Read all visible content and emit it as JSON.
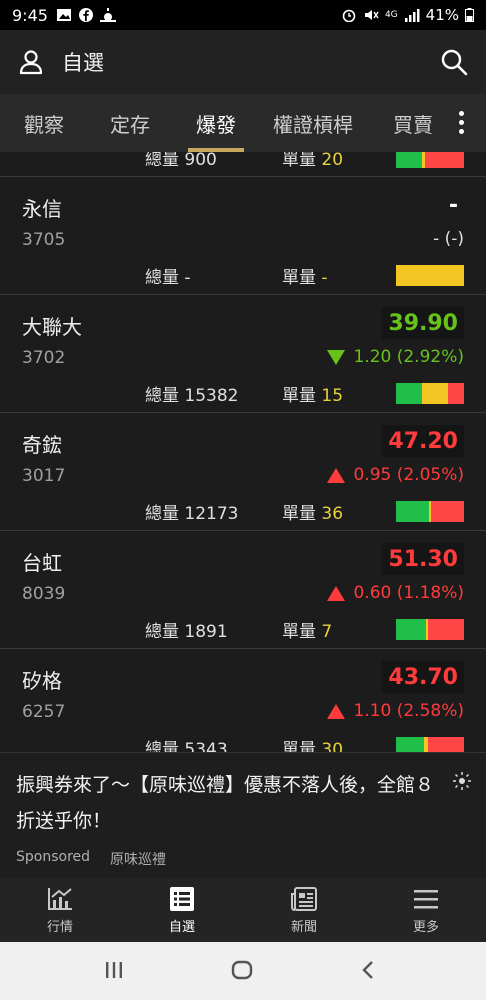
{
  "status_bar": {
    "time": "9:45",
    "battery": "41%",
    "network": "4G"
  },
  "header": {
    "title": "自選"
  },
  "tabs": [
    "觀察",
    "定存",
    "爆發",
    "權證槓桿",
    "買賣"
  ],
  "active_tab": "爆發",
  "stocks": [
    {
      "name": "",
      "code": "",
      "price": "",
      "change": "",
      "volume_label": "總量",
      "volume": "900",
      "unit_label": "單量",
      "unit": "20",
      "direction": "none"
    },
    {
      "name": "永信",
      "code": "3705",
      "price": "-",
      "change": "- (-)",
      "volume_label": "總量",
      "volume": "-",
      "unit_label": "單量",
      "unit": "-",
      "direction": "none"
    },
    {
      "name": "大聯大",
      "code": "3702",
      "price": "39.90",
      "change": "1.20 (2.92%)",
      "volume_label": "總量",
      "volume": "15382",
      "unit_label": "單量",
      "unit": "15",
      "direction": "down"
    },
    {
      "name": "奇鋐",
      "code": "3017",
      "price": "47.20",
      "change": "0.95 (2.05%)",
      "volume_label": "總量",
      "volume": "12173",
      "unit_label": "單量",
      "unit": "36",
      "direction": "up"
    },
    {
      "name": "台虹",
      "code": "8039",
      "price": "51.30",
      "change": "0.60 (1.18%)",
      "volume_label": "總量",
      "volume": "1891",
      "unit_label": "單量",
      "unit": "7",
      "direction": "up"
    },
    {
      "name": "矽格",
      "code": "6257",
      "price": "43.70",
      "change": "1.10 (2.58%)",
      "volume_label": "總量",
      "volume": "5343",
      "unit_label": "單量",
      "unit": "30",
      "direction": "up"
    }
  ],
  "ad": {
    "text": "振興券來了～【原味巡禮】優惠不落人後，全館８折送乎你！",
    "sponsored": "Sponsored",
    "brand": "原味巡禮"
  },
  "bottom_nav": [
    {
      "label": "行情",
      "icon": "chart-icon"
    },
    {
      "label": "自選",
      "icon": "list-icon"
    },
    {
      "label": "新聞",
      "icon": "news-icon"
    },
    {
      "label": "更多",
      "icon": "menu-icon"
    }
  ],
  "active_nav": "自選",
  "colors": {
    "up": "#ff3b3b",
    "down": "#67c21a",
    "accent": "#c7a75b",
    "unit": "#e8d23a"
  }
}
